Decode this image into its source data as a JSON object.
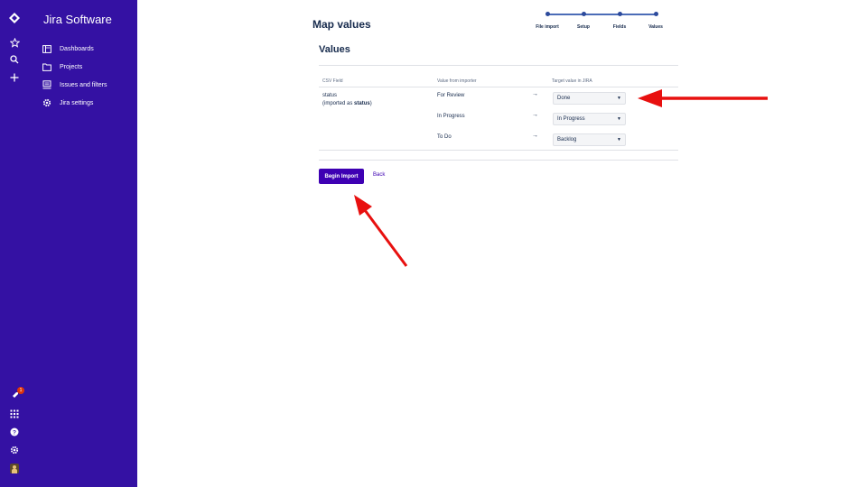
{
  "app": {
    "name": "Jira Software"
  },
  "sidebar": {
    "items": [
      {
        "label": "Dashboards",
        "icon": "dashboard-icon"
      },
      {
        "label": "Projects",
        "icon": "folder-icon"
      },
      {
        "label": "Issues and filters",
        "icon": "issues-icon"
      },
      {
        "label": "Jira settings",
        "icon": "gear-icon"
      }
    ]
  },
  "global_nav": {
    "icons": [
      "jira-logo-icon",
      "star-icon",
      "search-icon",
      "plus-icon",
      "rocket-icon",
      "app-switcher-icon",
      "help-icon",
      "settings-icon",
      "avatar"
    ],
    "notification_count": "1"
  },
  "page": {
    "title": "Map values"
  },
  "progress": {
    "steps": [
      "File import",
      "Setup",
      "Fields",
      "Values"
    ],
    "current": "Values"
  },
  "section": {
    "title": "Values"
  },
  "table": {
    "headers": [
      "CSV Field",
      "Value from importer",
      "Target value in JIRA"
    ],
    "field_name": "status",
    "field_note_prefix": "(imported as",
    "field_note_bold": "status",
    "field_note_suffix": ")",
    "arrow": "→",
    "rows": [
      {
        "importer_value": "For Review",
        "target_value": "Done"
      },
      {
        "importer_value": "In Progress",
        "target_value": "In Progress"
      },
      {
        "importer_value": "To Do",
        "target_value": "Backlog"
      }
    ]
  },
  "actions": {
    "primary": "Begin Import",
    "secondary": "Back"
  },
  "colors": {
    "sidebar_bg": "#3411a3",
    "primary_button": "#3e00b3",
    "annotation_arrow": "#e8100f"
  }
}
